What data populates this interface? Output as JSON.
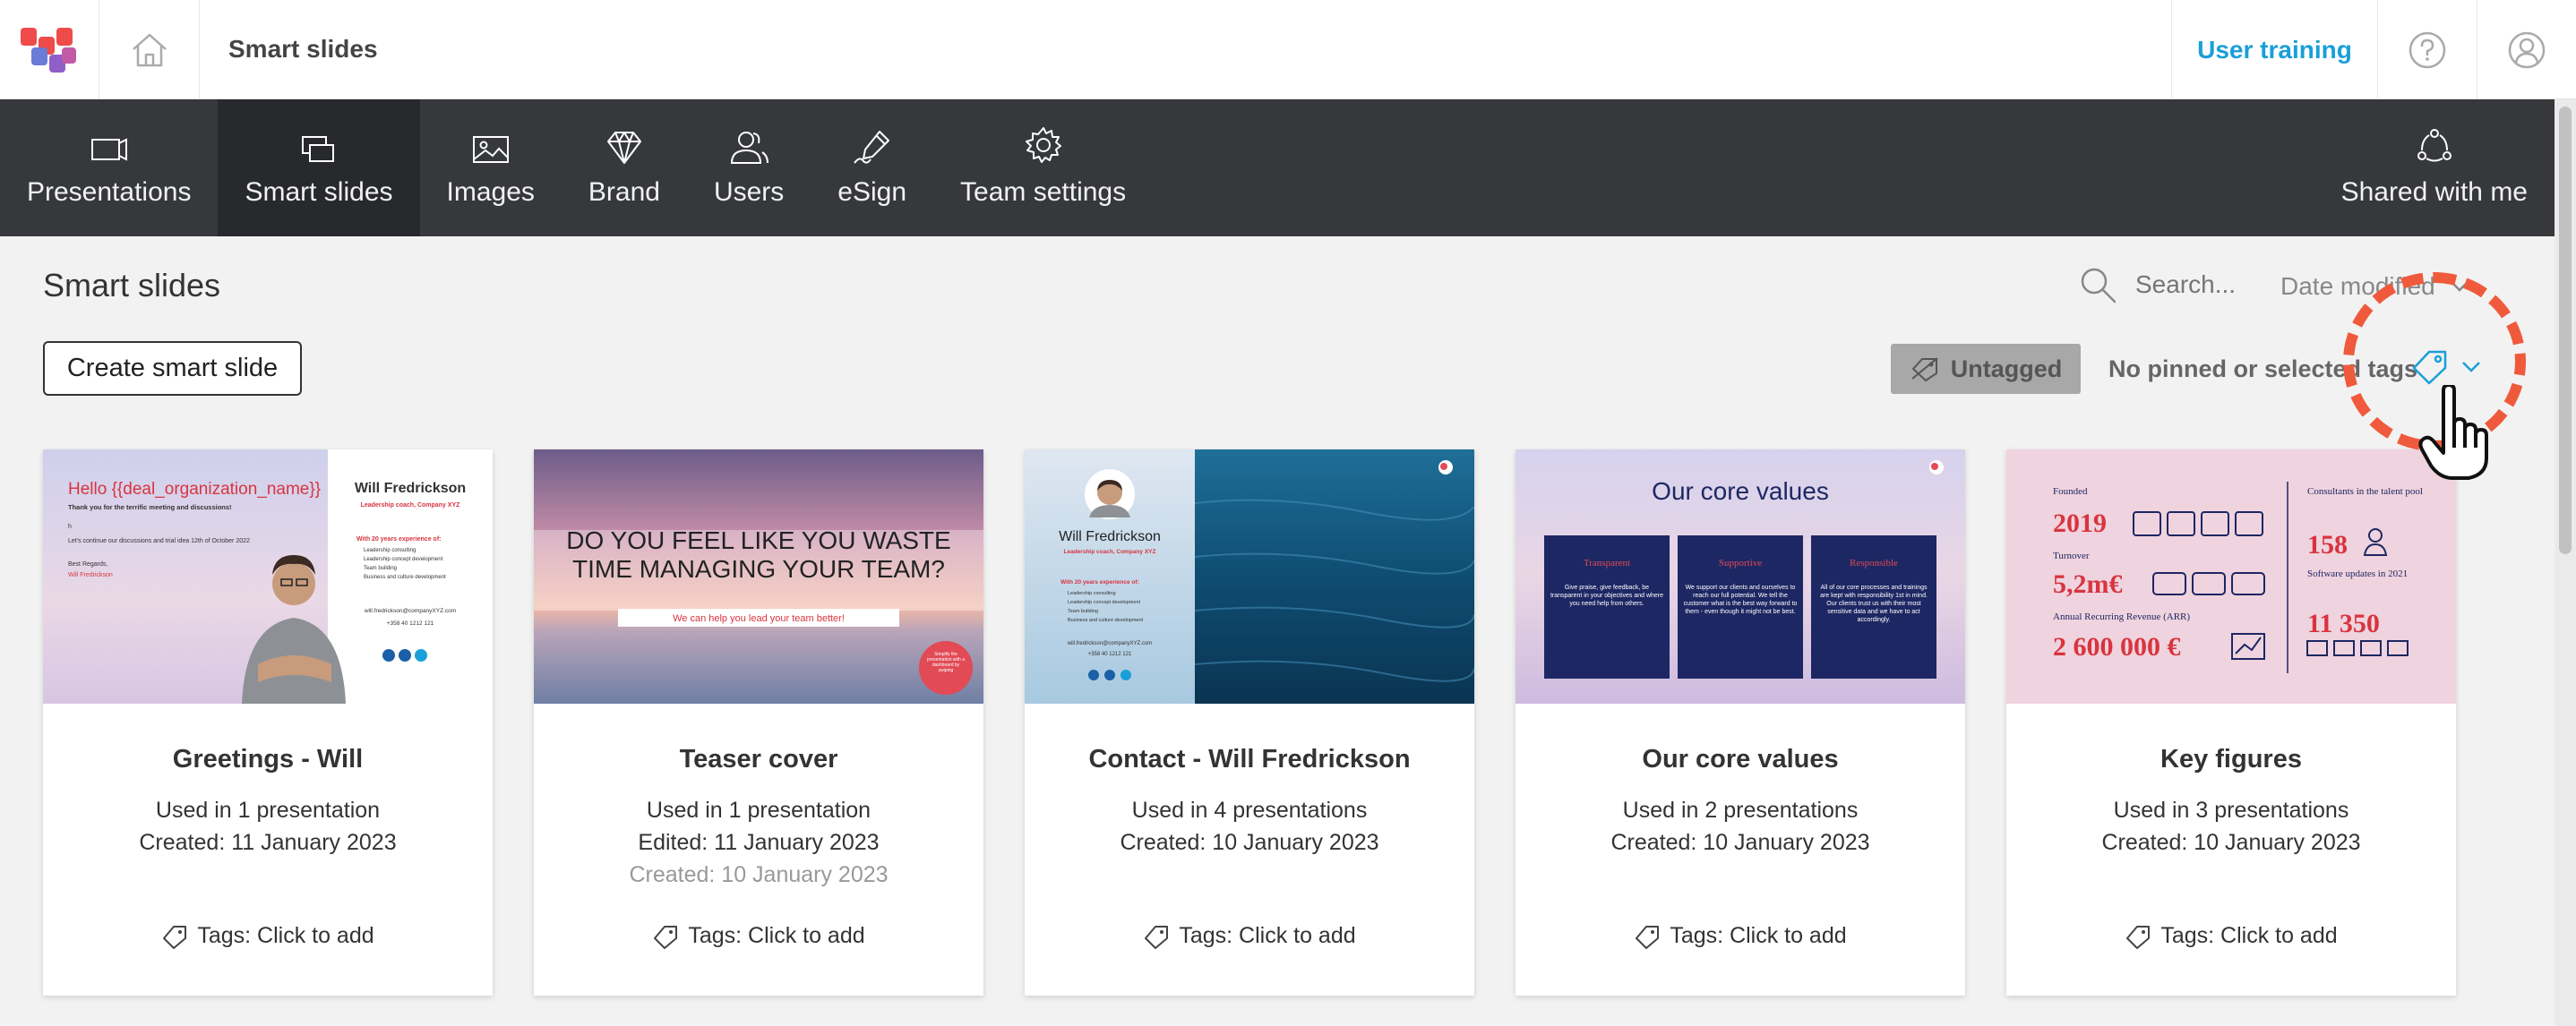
{
  "header": {
    "app_title": "Smart slides",
    "user_training": "User training"
  },
  "nav": {
    "items": [
      {
        "label": "Presentations"
      },
      {
        "label": "Smart slides"
      },
      {
        "label": "Images"
      },
      {
        "label": "Brand"
      },
      {
        "label": "Users"
      },
      {
        "label": "eSign"
      },
      {
        "label": "Team settings"
      }
    ],
    "shared": "Shared with me"
  },
  "main": {
    "heading": "Smart slides",
    "search_placeholder": "Search...",
    "sort": "Date modified",
    "create_button": "Create smart slide",
    "untagged": "Untagged",
    "pinned_text": "No pinned or selected tags"
  },
  "cards": [
    {
      "title": "Greetings - Will",
      "used": "Used in 1 presentation",
      "line2": "Created: 11 January 2023",
      "line3": "",
      "tags": "Tags: Click to add"
    },
    {
      "title": "Teaser cover",
      "used": "Used in 1 presentation",
      "line2": "Edited: 11 January 2023",
      "line3": "Created: 10 January 2023",
      "tags": "Tags: Click to add"
    },
    {
      "title": "Contact -  Will Fredrickson",
      "used": "Used in 4 presentations",
      "line2": "Created: 10 January 2023",
      "line3": "",
      "tags": "Tags: Click to add"
    },
    {
      "title": "Our core values",
      "used": "Used in 2 presentations",
      "line2": "Created: 10 January 2023",
      "line3": "",
      "tags": "Tags: Click to add"
    },
    {
      "title": "Key figures",
      "used": "Used in 3 presentations",
      "line2": "Created: 10 January 2023",
      "line3": "",
      "tags": "Tags: Click to add"
    }
  ],
  "thumbs": {
    "greetings": {
      "hello": "Hello {{deal_organization_name}}",
      "thanks": "Thank you for the terrific meeting and discussions!",
      "h": "h",
      "continue": "Let's continue our discussions and trial idea 12th of October 2022",
      "regards": "Best Regards,",
      "sig": "Will Fredrickson",
      "name": "Will Fredrickson",
      "role": "Leadership coach, Company XYZ",
      "exp": "With 20 years experience of:",
      "b1": "Leadership consulting",
      "b2": "Leadership concept development",
      "b3": "Team building",
      "b4": "Business and culture development",
      "email": "will.fredrickson@companyXYZ.com",
      "phone": "+358 40 1212 121"
    },
    "teaser": {
      "headline1": "DO YOU FEEL LIKE YOU WASTE",
      "headline2": "TIME MANAGING YOUR TEAM?",
      "sub": "We can help you lead your team better!",
      "badge": "Simplify the presentation with a dashboard by swiping"
    },
    "contact": {
      "name": "Will Fredrickson",
      "role": "Leadership coach, Company XYZ",
      "exp": "With 20 years experience of:",
      "b1": "Leadership consulting",
      "b2": "Leadership concept development",
      "b3": "Team building",
      "b4": "Business and culture development",
      "email": "will.fredrickson@companyXYZ.com",
      "phone": "+358 40 1212 121"
    },
    "values": {
      "title": "Our core values",
      "c1": "Transparent",
      "c1t": "Give praise, give feedback, be transparent in your objectives and where you need help from others.",
      "c2": "Supportive",
      "c2t": "We support our clients and ourselves to reach our full potential. We tell the customer what is the best way forward to them - even though it might not be best.",
      "c3": "Responsible",
      "c3t": "All of our core processes and trainings are kept with responsibility 1st in mind. Our clients trust us with their most sensitive data and we have to act accordingly."
    },
    "figures": {
      "founded": "Founded",
      "year": "2019",
      "turnover": "Turnover",
      "turnover_v": "5,2m€",
      "arr": "Annual Recurring Revenue (ARR)",
      "arr_v": "2 600 000 €",
      "consult": "Consultants in the talent pool",
      "consult_v": "158",
      "updates": "Software updates in 2021",
      "updates_v": "11 350"
    }
  },
  "colors": {
    "accent": "#1a9fd8",
    "nav_bg": "#36383c",
    "highlight": "#f05a3c"
  }
}
